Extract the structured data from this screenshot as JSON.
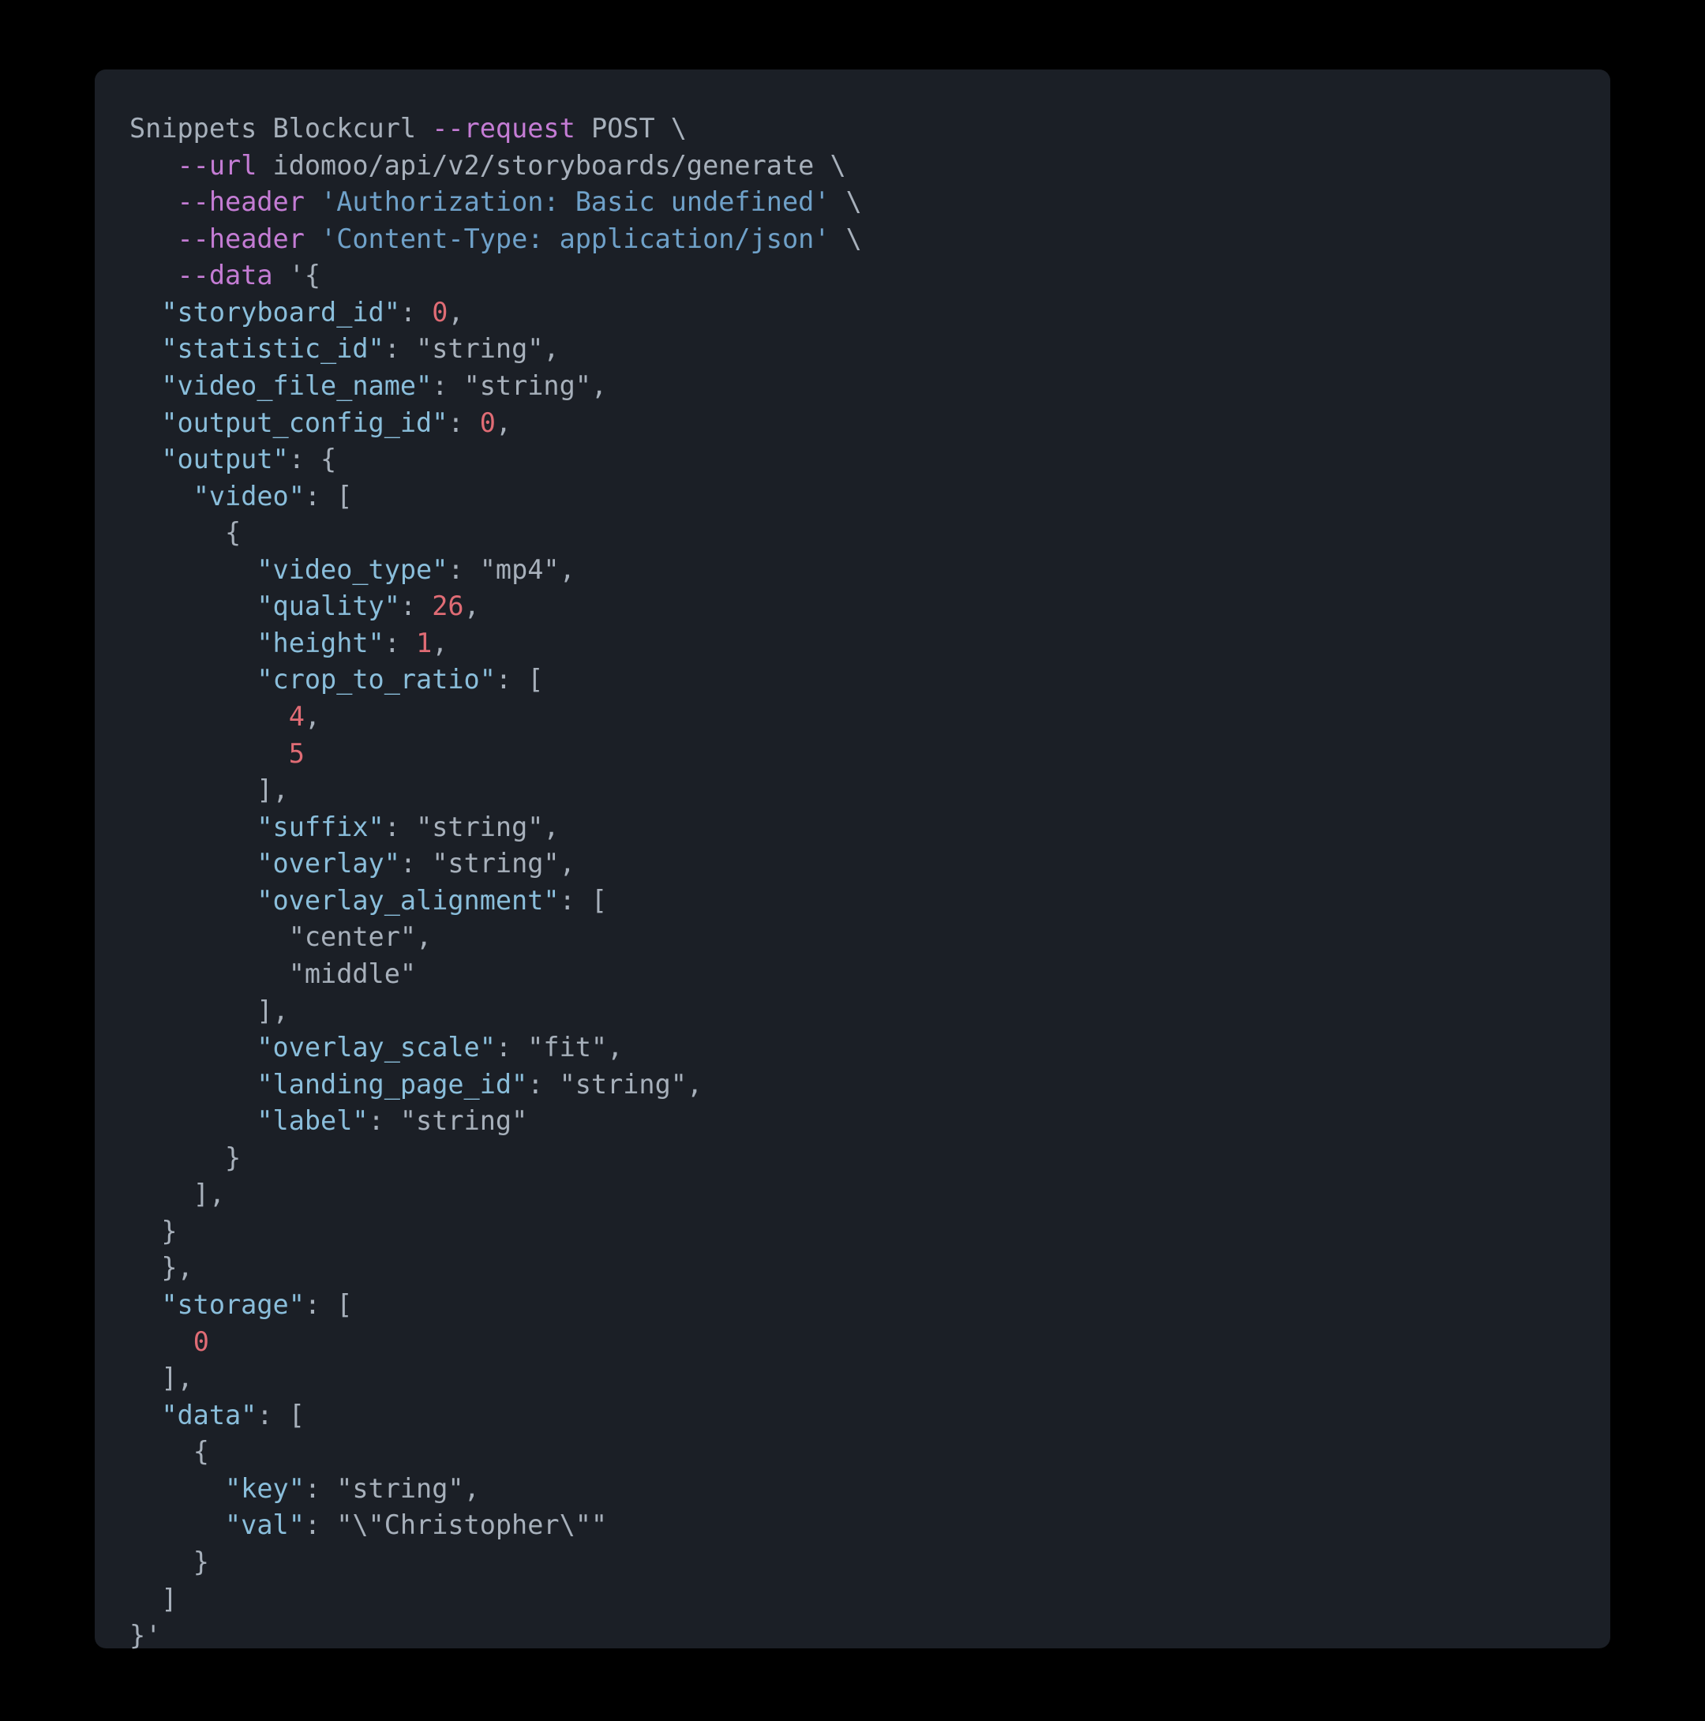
{
  "prefix": "Snippets Block",
  "curl": {
    "cmd": "curl",
    "flags": {
      "request": {
        "flag": "--request",
        "value": "POST"
      },
      "url": {
        "flag": "--url",
        "value": "idomoo/api/v2/storyboards/generate"
      },
      "header1": {
        "flag": "--header",
        "value": "'Authorization: Basic undefined'"
      },
      "header2": {
        "flag": "--header",
        "value": "'Content-Type: application/json'"
      },
      "data": {
        "flag": "--data",
        "value_open": "'{"
      }
    }
  },
  "json": {
    "storyboard_id_key": "\"storyboard_id\"",
    "storyboard_id_val": "0",
    "statistic_id_key": "\"statistic_id\"",
    "statistic_id_val": "\"string\"",
    "video_file_name_key": "\"video_file_name\"",
    "video_file_name_val": "\"string\"",
    "output_config_id_key": "\"output_config_id\"",
    "output_config_id_val": "0",
    "output_key": "\"output\"",
    "video_key": "\"video\"",
    "video_type_key": "\"video_type\"",
    "video_type_val": "\"mp4\"",
    "quality_key": "\"quality\"",
    "quality_val": "26",
    "height_key": "\"height\"",
    "height_val": "1",
    "crop_to_ratio_key": "\"crop_to_ratio\"",
    "crop_a": "4",
    "crop_b": "5",
    "suffix_key": "\"suffix\"",
    "suffix_val": "\"string\"",
    "overlay_key": "\"overlay\"",
    "overlay_val": "\"string\"",
    "overlay_alignment_key": "\"overlay_alignment\"",
    "overlay_alignment_a": "\"center\"",
    "overlay_alignment_b": "\"middle\"",
    "overlay_scale_key": "\"overlay_scale\"",
    "overlay_scale_val": "\"fit\"",
    "landing_page_id_key": "\"landing_page_id\"",
    "landing_page_id_val": "\"string\"",
    "label_key": "\"label\"",
    "label_val": "\"string\"",
    "storage_key": "\"storage\"",
    "storage_val": "0",
    "data_key": "\"data\"",
    "data_item_key_key": "\"key\"",
    "data_item_key_val": "\"string\"",
    "data_item_val_key": "\"val\"",
    "data_item_val_val": "\"\\\"Christopher\\\"\"",
    "close": "}'"
  },
  "backslash": "\\",
  "indent1": "   ",
  "indent2": "  ",
  "indent3": "    ",
  "indent4": "      ",
  "indent5": "        ",
  "indent6": "          "
}
